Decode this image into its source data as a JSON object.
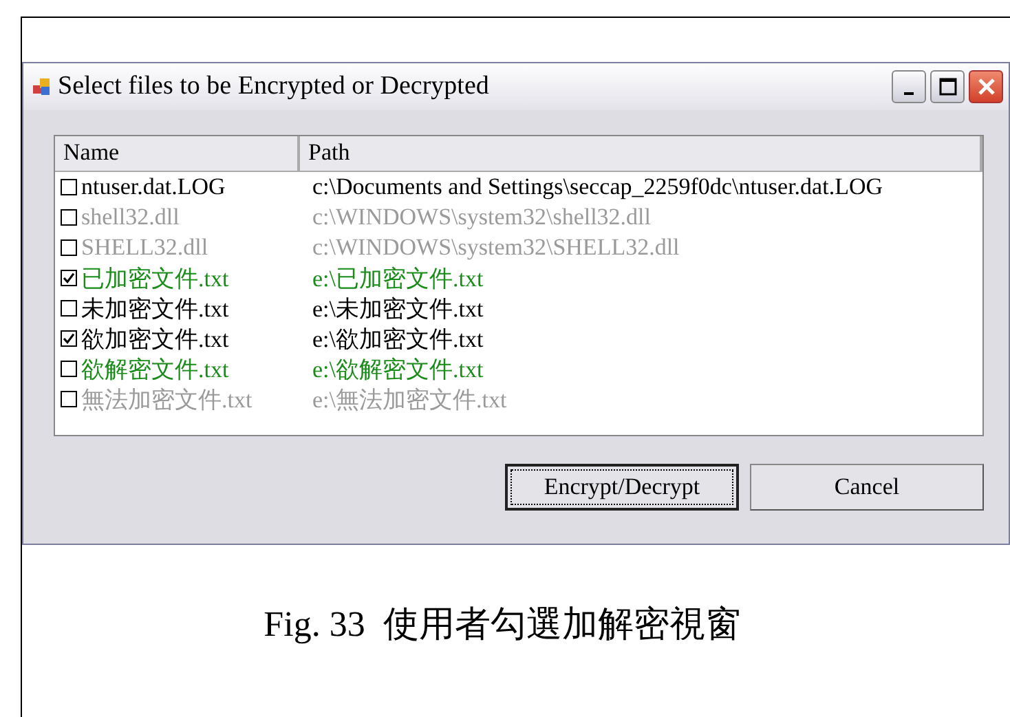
{
  "window": {
    "title": "Select files to be Encrypted or Decrypted"
  },
  "list": {
    "columns": [
      "Name",
      "Path"
    ],
    "rows": [
      {
        "name": "ntuser.dat.LOG",
        "path": "c:\\Documents and Settings\\seccap_2259f0dc\\ntuser.dat.LOG",
        "checked": false,
        "color": "#000000"
      },
      {
        "name": "shell32.dll",
        "path": "c:\\WINDOWS\\system32\\shell32.dll",
        "checked": false,
        "color": "#9a9a9a"
      },
      {
        "name": "SHELL32.dll",
        "path": "c:\\WINDOWS\\system32\\SHELL32.dll",
        "checked": false,
        "color": "#9a9a9a"
      },
      {
        "name": "已加密文件.txt",
        "path": "e:\\已加密文件.txt",
        "checked": true,
        "color": "#1a8c1a"
      },
      {
        "name": "未加密文件.txt",
        "path": "e:\\未加密文件.txt",
        "checked": false,
        "color": "#000000"
      },
      {
        "name": "欲加密文件.txt",
        "path": "e:\\欲加密文件.txt",
        "checked": true,
        "color": "#000000"
      },
      {
        "name": "欲解密文件.txt",
        "path": "e:\\欲解密文件.txt",
        "checked": false,
        "color": "#1a8c1a"
      },
      {
        "name": "無法加密文件.txt",
        "path": "e:\\無法加密文件.txt",
        "checked": false,
        "color": "#9a9a9a"
      }
    ]
  },
  "buttons": [
    "Encrypt/Decrypt",
    "Cancel"
  ],
  "caption": "Fig. 33  使用者勾選加解密視窗"
}
